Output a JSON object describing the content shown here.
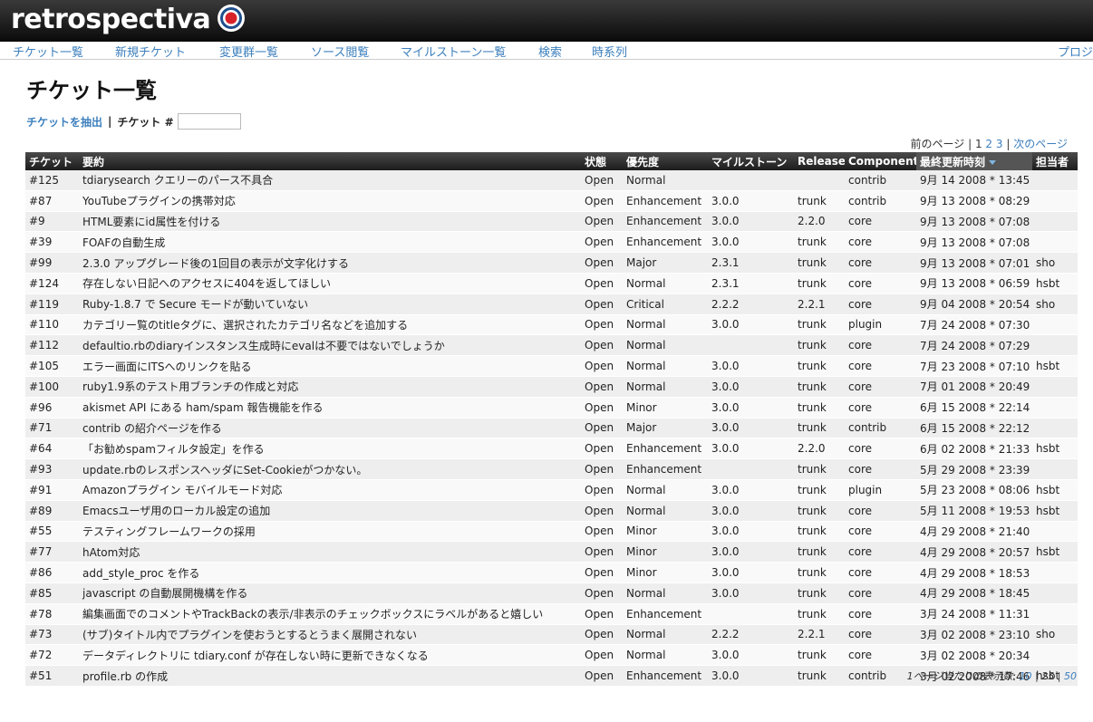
{
  "app": {
    "brand": "retrospectiva"
  },
  "nav": {
    "items": [
      "チケット一覧",
      "新規チケット",
      "変更群一覧",
      "ソース閲覧",
      "マイルストーン一覧",
      "検索",
      "時系列"
    ],
    "right_item": "プロジ"
  },
  "page": {
    "title": "チケット一覧",
    "filter_link": "チケットを抽出",
    "separator": "|",
    "ticket_label": "チケット #",
    "ticket_input_value": ""
  },
  "pager": {
    "prev": "前のページ",
    "sep": "|",
    "pages": [
      "1",
      "2",
      "3"
    ],
    "next": "次のページ"
  },
  "table": {
    "headers": [
      "チケット",
      "要約",
      "状態",
      "優先度",
      "マイルストーン",
      "Release",
      "Component",
      "最終更新時刻",
      "担当者"
    ],
    "rows": [
      [
        "#125",
        "tdiarysearch クエリーのパース不具合",
        "Open",
        "Normal",
        "",
        "",
        "contrib",
        "9月 14 2008 * 13:45",
        ""
      ],
      [
        "#87",
        "YouTubeプラグインの携帯対応",
        "Open",
        "Enhancement",
        "3.0.0",
        "trunk",
        "contrib",
        "9月 13 2008 * 08:29",
        ""
      ],
      [
        "#9",
        "HTML要素にid属性を付ける",
        "Open",
        "Enhancement",
        "3.0.0",
        "2.2.0",
        "core",
        "9月 13 2008 * 07:08",
        ""
      ],
      [
        "#39",
        "FOAFの自動生成",
        "Open",
        "Enhancement",
        "3.0.0",
        "trunk",
        "core",
        "9月 13 2008 * 07:08",
        ""
      ],
      [
        "#99",
        "2.3.0 アップグレード後の1回目の表示が文字化けする",
        "Open",
        "Major",
        "2.3.1",
        "trunk",
        "core",
        "9月 13 2008 * 07:01",
        "sho"
      ],
      [
        "#124",
        "存在しない日記へのアクセスに404を返してほしい",
        "Open",
        "Normal",
        "2.3.1",
        "trunk",
        "core",
        "9月 13 2008 * 06:59",
        "hsbt"
      ],
      [
        "#119",
        "Ruby-1.8.7 で Secure モードが動いていない",
        "Open",
        "Critical",
        "2.2.2",
        "2.2.1",
        "core",
        "9月 04 2008 * 20:54",
        "sho"
      ],
      [
        "#110",
        "カテゴリー覧のtitleタグに、選択されたカテゴリ名などを追加する",
        "Open",
        "Normal",
        "3.0.0",
        "trunk",
        "plugin",
        "7月 24 2008 * 07:30",
        ""
      ],
      [
        "#112",
        "defaultio.rbのdiaryインスタンス生成時にevalは不要ではないでしょうか",
        "Open",
        "Normal",
        "",
        "trunk",
        "core",
        "7月 24 2008 * 07:29",
        ""
      ],
      [
        "#105",
        "エラー画面にITSへのリンクを貼る",
        "Open",
        "Normal",
        "3.0.0",
        "trunk",
        "core",
        "7月 23 2008 * 07:10",
        "hsbt"
      ],
      [
        "#100",
        "ruby1.9系のテスト用ブランチの作成と対応",
        "Open",
        "Normal",
        "3.0.0",
        "trunk",
        "core",
        "7月 01 2008 * 20:49",
        ""
      ],
      [
        "#96",
        "akismet API にある ham/spam 報告機能を作る",
        "Open",
        "Minor",
        "3.0.0",
        "trunk",
        "core",
        "6月 15 2008 * 22:14",
        ""
      ],
      [
        "#71",
        "contrib の紹介ページを作る",
        "Open",
        "Major",
        "3.0.0",
        "trunk",
        "contrib",
        "6月 15 2008 * 22:12",
        ""
      ],
      [
        "#64",
        "「お勧めspamフィルタ設定」を作る",
        "Open",
        "Enhancement",
        "3.0.0",
        "2.2.0",
        "core",
        "6月 02 2008 * 21:33",
        "hsbt"
      ],
      [
        "#93",
        "update.rbのレスポンスヘッダにSet-Cookieがつかない。",
        "Open",
        "Enhancement",
        "",
        "trunk",
        "core",
        "5月 29 2008 * 23:39",
        ""
      ],
      [
        "#91",
        "Amazonプラグイン モバイルモード対応",
        "Open",
        "Normal",
        "3.0.0",
        "trunk",
        "plugin",
        "5月 23 2008 * 08:06",
        "hsbt"
      ],
      [
        "#89",
        "Emacsユーザ用のローカル設定の追加",
        "Open",
        "Normal",
        "3.0.0",
        "trunk",
        "core",
        "5月 11 2008 * 19:53",
        "hsbt"
      ],
      [
        "#55",
        "テスティングフレームワークの採用",
        "Open",
        "Minor",
        "3.0.0",
        "trunk",
        "core",
        "4月 29 2008 * 21:40",
        ""
      ],
      [
        "#77",
        "hAtom対応",
        "Open",
        "Minor",
        "3.0.0",
        "trunk",
        "core",
        "4月 29 2008 * 20:57",
        "hsbt"
      ],
      [
        "#86",
        "add_style_proc を作る",
        "Open",
        "Minor",
        "3.0.0",
        "trunk",
        "core",
        "4月 29 2008 * 18:53",
        ""
      ],
      [
        "#85",
        "javascript の自動展開機構を作る",
        "Open",
        "Normal",
        "3.0.0",
        "trunk",
        "core",
        "4月 29 2008 * 18:45",
        ""
      ],
      [
        "#78",
        "編集画面でのコメントやTrackBackの表示/非表示のチェックボックスにラベルがあると嬉しい",
        "Open",
        "Enhancement",
        "",
        "trunk",
        "core",
        "3月 24 2008 * 11:31",
        ""
      ],
      [
        "#73",
        "(サブ)タイトル内でプラグインを使おうとするとうまく展開されない",
        "Open",
        "Normal",
        "2.2.2",
        "2.2.1",
        "core",
        "3月 02 2008 * 23:10",
        "sho"
      ],
      [
        "#72",
        "データディレクトリに tdiary.conf が存在しない時に更新できなくなる",
        "Open",
        "Normal",
        "3.0.0",
        "trunk",
        "core",
        "3月 02 2008 * 20:34",
        ""
      ],
      [
        "#51",
        "profile.rb の作成",
        "Open",
        "Enhancement",
        "3.0.0",
        "trunk",
        "contrib",
        "3月 02 2008 * 17:46",
        "hsbt"
      ]
    ]
  },
  "perpage": {
    "label": "1ページ当たりの表示数:",
    "options": [
      "10",
      "25",
      "50"
    ],
    "sep": "|"
  },
  "colors": {
    "link": "#3c7fbd",
    "header_bg": "#1c1c1c",
    "row_odd": "#eeeeee",
    "row_even": "#f9f9f9"
  }
}
